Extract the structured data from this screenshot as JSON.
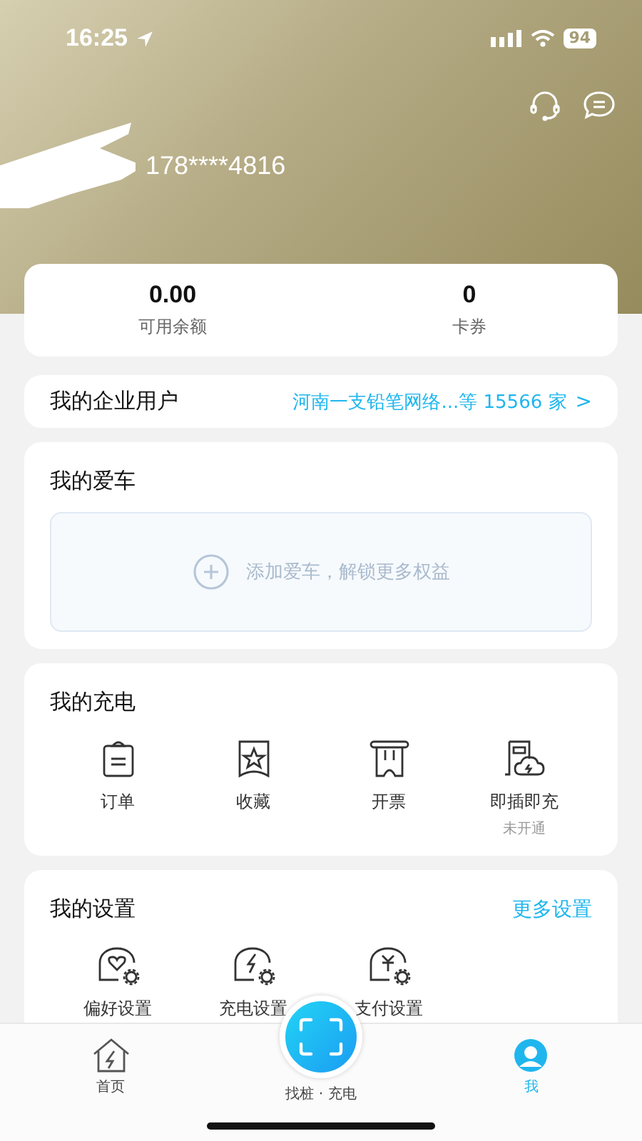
{
  "status_bar": {
    "time": "16:25",
    "battery": "94"
  },
  "profile": {
    "phone": "178****4816"
  },
  "balance": [
    {
      "value": "0.00",
      "label": "可用余额"
    },
    {
      "value": "0",
      "label": "卡券"
    }
  ],
  "enterprise": {
    "title": "我的企业用户",
    "value": "河南一支铅笔网络...等 15566 家",
    "chevron": ">"
  },
  "car": {
    "title": "我的爱车",
    "add_text": "添加爱车，解锁更多权益"
  },
  "charging": {
    "title": "我的充电",
    "items": [
      {
        "label": "订单"
      },
      {
        "label": "收藏"
      },
      {
        "label": "开票"
      },
      {
        "label": "即插即充",
        "note": "未开通"
      }
    ]
  },
  "settings": {
    "title": "我的设置",
    "more": "更多设置",
    "items": [
      {
        "label": "偏好设置"
      },
      {
        "label": "充电设置"
      },
      {
        "label": "支付设置"
      }
    ]
  },
  "tabs": [
    {
      "label": "首页",
      "selected": false
    },
    {
      "label": "找桩 · 充电",
      "selected": false
    },
    {
      "label": "我",
      "selected": true
    }
  ]
}
